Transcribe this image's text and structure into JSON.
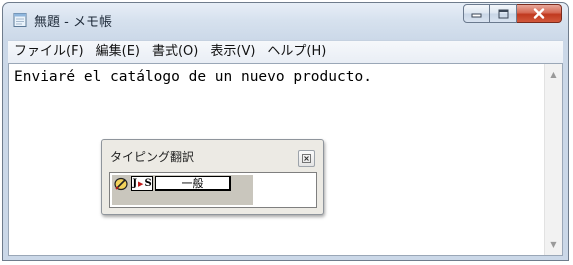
{
  "window": {
    "title": "無題 - メモ帳",
    "icons": {
      "app": "notepad-icon",
      "minimize": "minimize-icon",
      "maximize": "maximize-icon",
      "close": "close-icon"
    }
  },
  "menubar": {
    "items": [
      {
        "label": "ファイル(F)"
      },
      {
        "label": "編集(E)"
      },
      {
        "label": "書式(O)"
      },
      {
        "label": "表示(V)"
      },
      {
        "label": "ヘルプ(H)"
      }
    ]
  },
  "editor": {
    "text": "Enviaré el catálogo de un nuevo producto."
  },
  "ime": {
    "title": "タイピング翻訳",
    "close_icon": "close-icon",
    "toolbar": {
      "pen_icon": "pen-icon",
      "direction_from": "J",
      "direction_to": "S",
      "mode": "一般"
    }
  },
  "colors": {
    "close_button": "#c8472f",
    "titlebar": "#d6e1ee",
    "direction_arrow": "#c01818"
  }
}
